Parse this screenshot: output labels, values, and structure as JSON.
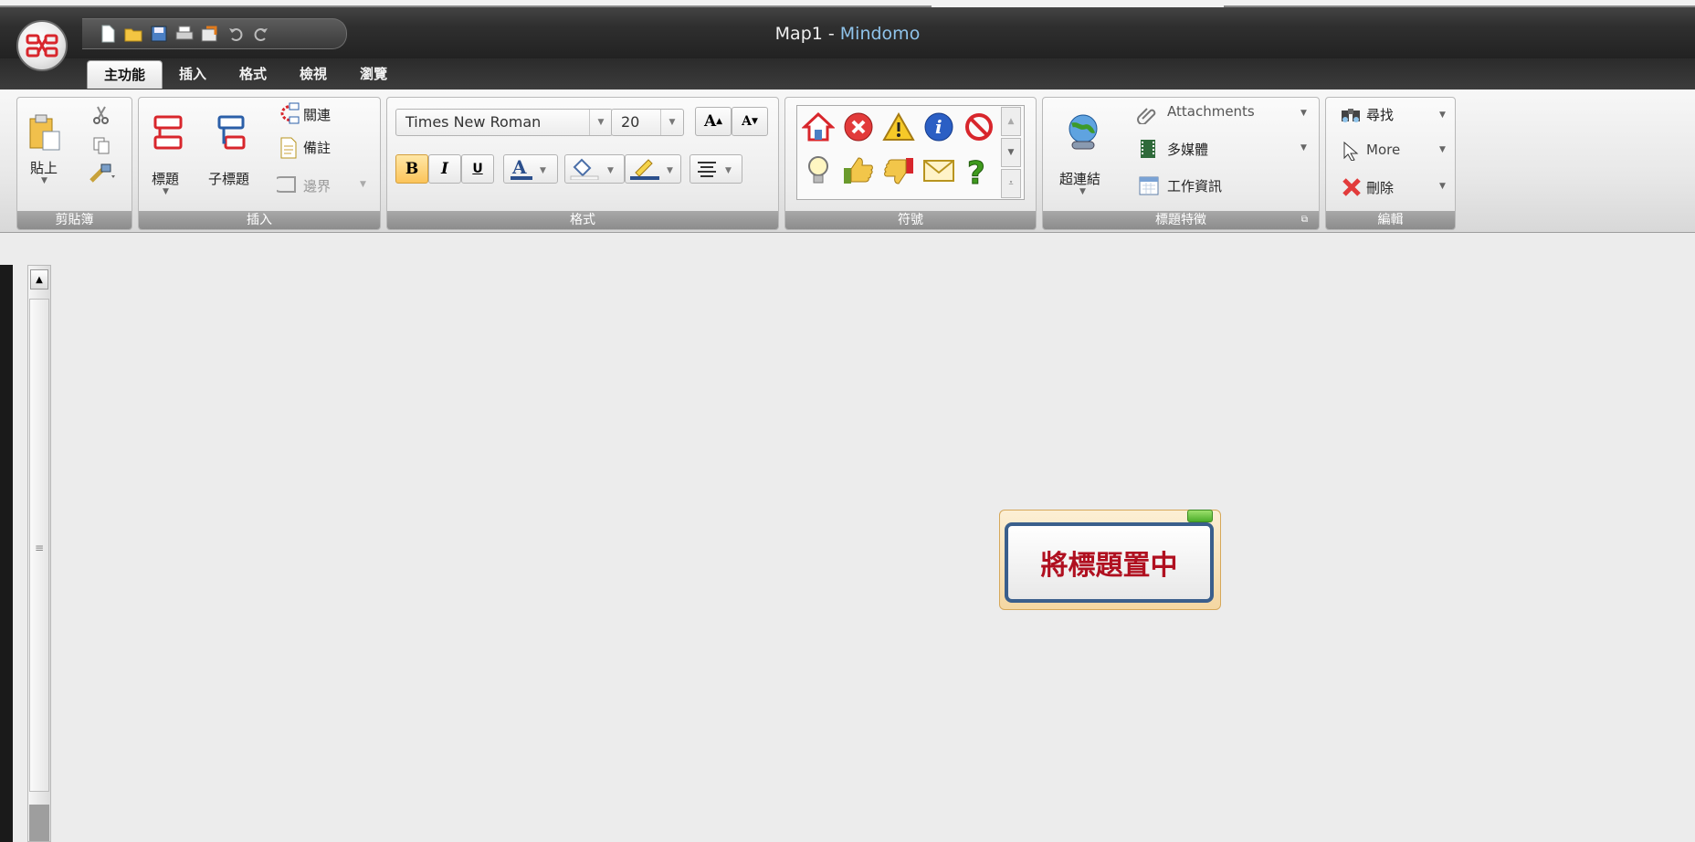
{
  "window": {
    "title_doc": "Map1",
    "title_sep": " - ",
    "title_app": "Mindomo"
  },
  "qat": {
    "icons": [
      "new-document-icon",
      "open-folder-icon",
      "save-icon",
      "print-icon",
      "export-icon",
      "undo-icon",
      "redo-icon"
    ]
  },
  "tabs": [
    "主功能",
    "插入",
    "格式",
    "檢視",
    "瀏覽"
  ],
  "active_tab": "主功能",
  "ribbon": {
    "clipboard": {
      "label": "剪貼簿",
      "paste": "貼上"
    },
    "insert": {
      "label": "插入",
      "topic": "標題",
      "subtopic": "子標題",
      "relation": "關連",
      "note": "備註",
      "boundary": "邊界"
    },
    "format": {
      "label": "格式",
      "font": "Times New Roman",
      "size": "20",
      "bold": "B",
      "italic": "I",
      "underline": "U",
      "grow": "A",
      "shrink": "A"
    },
    "markers": {
      "label": "符號"
    },
    "topic_features": {
      "label": "標題特徵",
      "hyperlink": "超連結",
      "attachments": "Attachments",
      "multimedia": "多媒體",
      "task": "工作資訊"
    },
    "edit": {
      "label": "編輯",
      "find": "尋找",
      "more": "More",
      "delete": "刪除"
    }
  },
  "canvas": {
    "topic_text": "將標題置中"
  },
  "colors": {
    "titlebar": "#2f2f2f",
    "app_title_accent": "#8fc3ea",
    "topic_text": "#b01020",
    "topic_border": "#3a5f8c"
  }
}
